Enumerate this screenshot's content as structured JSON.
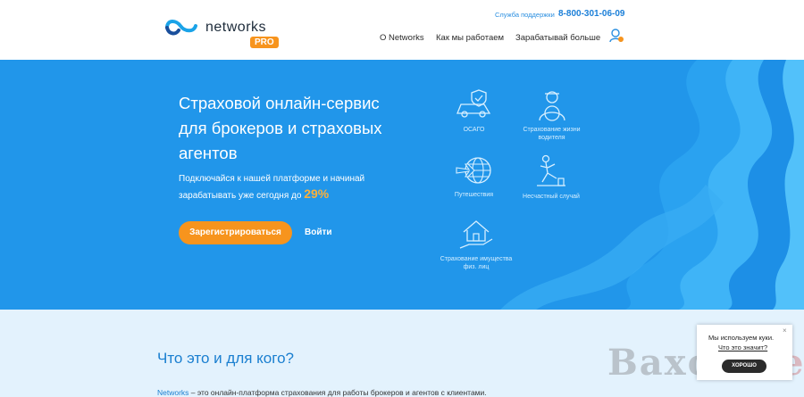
{
  "header": {
    "logo_text": "networks",
    "logo_badge": "PRO",
    "support_label": "Служба поддержки",
    "phone": "8-800-301-06-09",
    "nav": [
      "О Networks",
      "Как мы работаем",
      "Зарабатывай больше"
    ],
    "user_icon": "user-icon"
  },
  "hero": {
    "title": "Страховой онлайн-сервис для брокеров и страховых агентов",
    "subtitle": "Подключайся к нашей платформе и начинай зарабатывать уже сегодня до",
    "percent": "29%",
    "register_label": "Зарегистрироваться",
    "login_label": "Войти",
    "services": [
      {
        "label": "ОСАГО",
        "icon": "car-shield-icon"
      },
      {
        "label": "Страхование жизни водителя",
        "icon": "driver-icon"
      },
      {
        "label": "Путешествия",
        "icon": "globe-plane-icon"
      },
      {
        "label": "Несчастный случай",
        "icon": "falling-person-icon"
      },
      {
        "label": "Страхование имущества физ. лиц",
        "icon": "house-hand-icon"
      }
    ]
  },
  "lower": {
    "title": "Что это и для кого?",
    "brand": "Networks",
    "text": " – это онлайн-платформа страхования для работы брокеров и агентов с клиентами."
  },
  "cookie": {
    "text": "Мы используем куки.",
    "link": "Что это значит?",
    "close": "×",
    "button": "ХОРОШО"
  },
  "watermark": {
    "name": "Baxov.",
    "domain": "Net"
  },
  "colors": {
    "hero_bg": "#2196ea",
    "accent_orange": "#f7941d",
    "link_blue": "#1a7fd0",
    "lower_bg": "#e3f2fd"
  }
}
